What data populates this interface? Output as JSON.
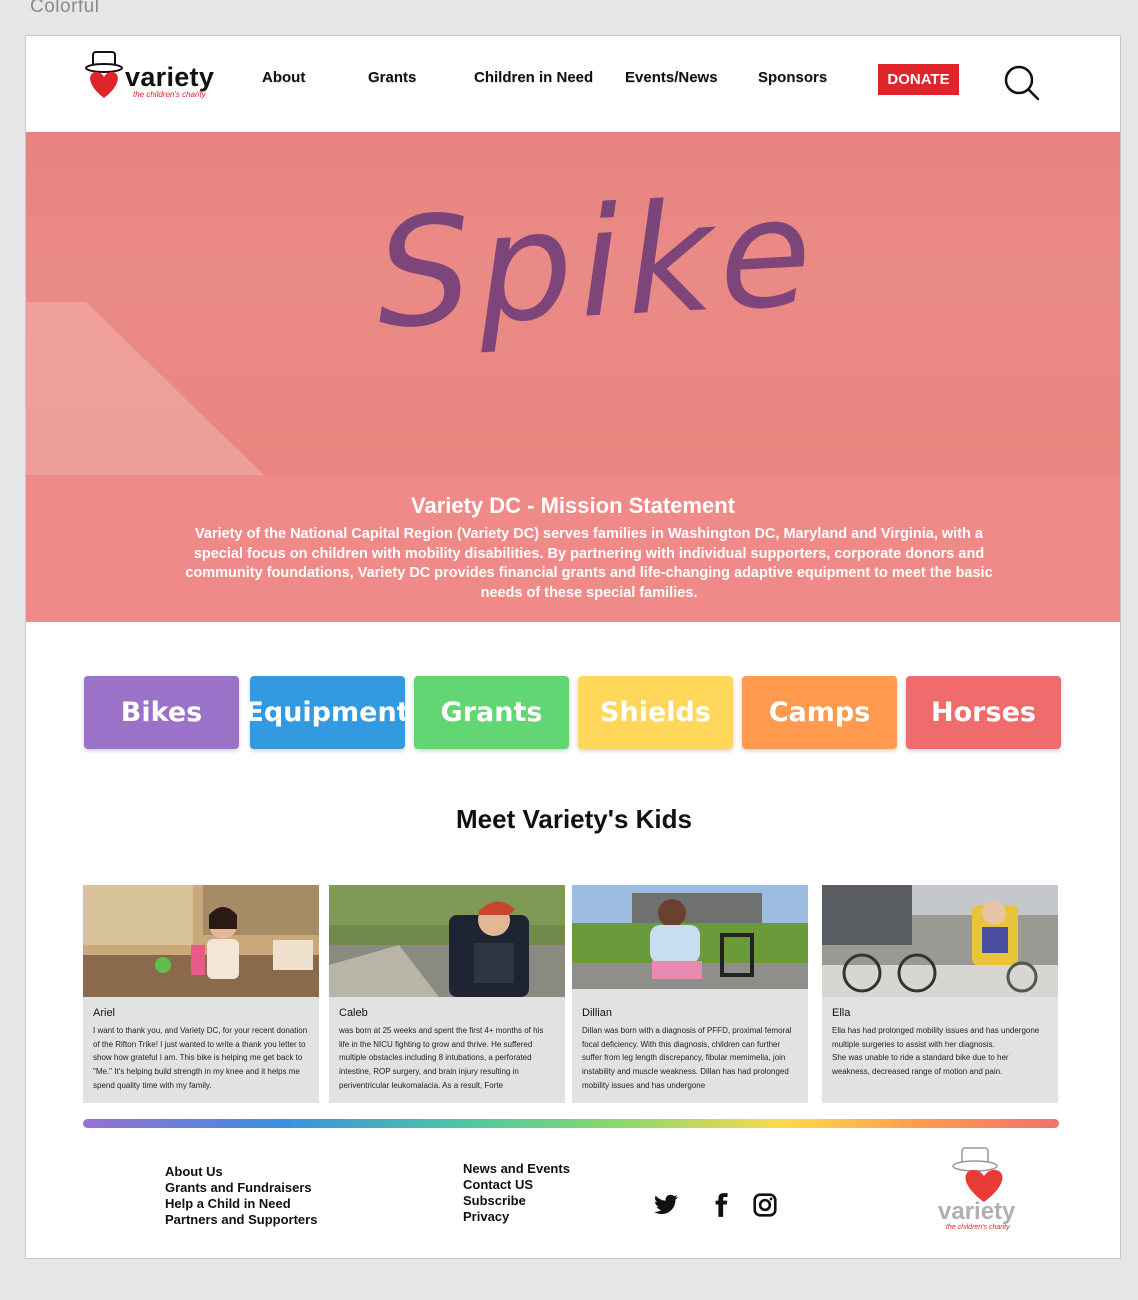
{
  "artboard": {
    "label": "Colorful"
  },
  "header": {
    "logo": {
      "word": "variety",
      "tagline": "the children's charity"
    },
    "nav": [
      "About",
      "Grants",
      "Children in Need",
      "Events/News",
      "Sponsors"
    ],
    "donate_label": "DONATE",
    "search_icon": "search-icon"
  },
  "hero": {
    "image_text": "Spike",
    "mission_title": "Variety DC - Mission Statement",
    "mission_body": "Variety of the National Capital Region (Variety DC) serves families in Washington DC, Maryland and Virginia, with a special focus on children with mobility disabilities.  By partnering with individual supporters, corporate donors and community foundations, Variety DC provides financial grants and life-changing adaptive equipment to meet the basic needs of these special families."
  },
  "categories": [
    {
      "label": "Bikes",
      "color": "#9a72c8"
    },
    {
      "label": "Equipment",
      "color": "#3399e0"
    },
    {
      "label": "Grants",
      "color": "#62d672"
    },
    {
      "label": "Shields",
      "color": "#ffd75a"
    },
    {
      "label": "Camps",
      "color": "#ff9a4f"
    },
    {
      "label": "Horses",
      "color": "#f06b6b"
    }
  ],
  "kids": {
    "title": "Meet Variety's Kids",
    "cards": [
      {
        "name": "Ariel",
        "text": "I want to thank you, and Variety DC, for your recent donation of the Rifton Trike! I just wanted to write a thank you letter to show how grateful I am.  This bike is helping me get back to \"Me.\"  It's helping build strength in my knee and it helps me spend quality time with my family."
      },
      {
        "name": "Caleb",
        "text": "was born at 25 weeks and spent the first 4+ months of his life in the NICU fighting to grow and thrive. He suffered multiple obstacles including 8 intubations, a perforated intestine, ROP surgery, and brain injury resulting in periventricular leukomalacia. As a result, Forte"
      },
      {
        "name": "Dillian",
        "text": "Dillan was born with a diagnosis of PFFD, proximal femoral focal deficiency. With this diagnosis, children can further suffer from leg length discrepancy, fibular memimelia, join instability and muscle weakness. Dillan has had prolonged mobility issues and has undergone"
      },
      {
        "name": "Ella",
        "text": "Ella  has had prolonged mobility issues and has undergone multiple surgeries to assist with her diagnosis.\nShe was unable to ride a standard bike due to her weakness, decreased range of motion and pain."
      }
    ]
  },
  "footer": {
    "col1": [
      "About Us",
      "Grants and Fundraisers",
      "Help a Child in Need",
      "Partners and Supporters"
    ],
    "col2": [
      "News and Events",
      "Contact US",
      "Subscribe",
      "Privacy"
    ],
    "social": [
      "twitter-icon",
      "facebook-icon",
      "instagram-icon"
    ],
    "logo": {
      "word": "variety",
      "tagline": "the children's charity"
    }
  }
}
